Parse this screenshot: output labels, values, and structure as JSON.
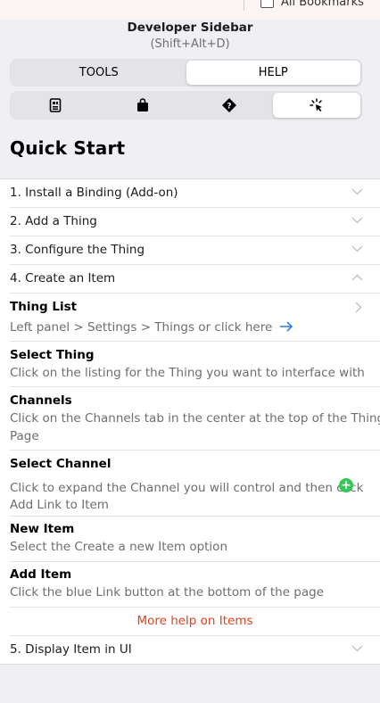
{
  "top_bar": {
    "bookmarks_label": "All Bookmarks"
  },
  "header": {
    "title": "Developer Sidebar",
    "shortcut": "(Shift+Alt+D)"
  },
  "tabs": [
    {
      "label": "TOOLS",
      "active": false
    },
    {
      "label": "HELP",
      "active": true
    }
  ],
  "icon_tabs": [
    {
      "icon": "file-icon",
      "active": false
    },
    {
      "icon": "bag-icon",
      "active": false
    },
    {
      "icon": "help-diamond-icon",
      "active": false
    },
    {
      "icon": "cursor-click-icon",
      "active": true
    }
  ],
  "page_title": "Quick Start",
  "sections": [
    {
      "label": "1. Install a Binding (Add-on)",
      "expanded": false
    },
    {
      "label": "2. Add a Thing",
      "expanded": false
    },
    {
      "label": "3. Configure the Thing",
      "expanded": false
    },
    {
      "label": "4. Create an Item",
      "expanded": true
    },
    {
      "label": "5. Display Item in UI",
      "expanded": false
    }
  ],
  "steps": [
    {
      "title": "Thing List",
      "desc": "Left panel > Settings > Things or click here"
    },
    {
      "title": "Select Thing",
      "desc": "Click on the listing for the Thing you want to interface with"
    },
    {
      "title": "Channels",
      "desc_line1": "Click on the Channels tab in the center at the top of the Thing",
      "desc_line2": "Page"
    },
    {
      "title": "Select Channel",
      "desc_line1": "Click to expand the Channel you will control and then click",
      "desc_line2": "Add Link to Item"
    },
    {
      "title": "New Item",
      "desc": "Select the Create a new Item option"
    },
    {
      "title": "Add Item",
      "desc": "Click the blue Link button at the bottom of the page"
    }
  ],
  "more_help": "More help on Items",
  "colors": {
    "accent_link": "#e0431c",
    "arrow_blue": "#2f7fe0",
    "add_green": "#34c759"
  }
}
